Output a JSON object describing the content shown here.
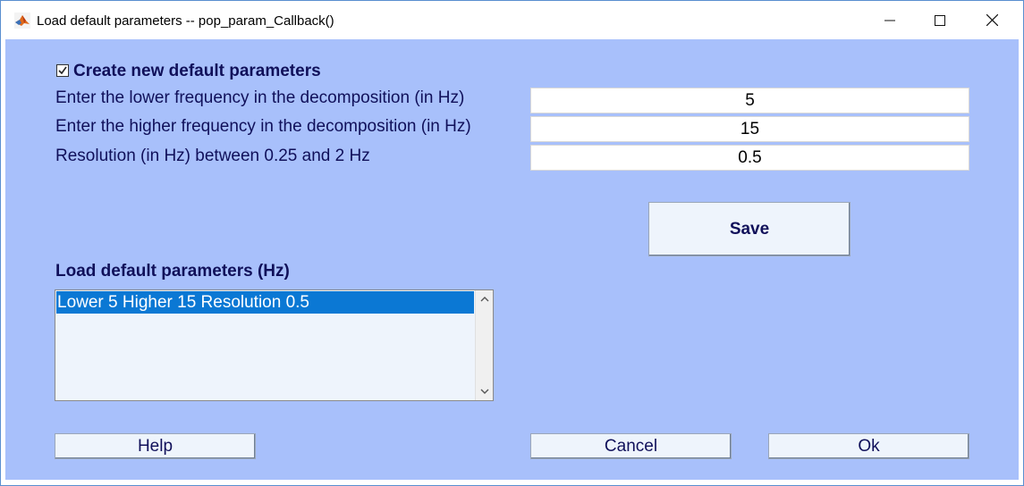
{
  "window": {
    "title": "Load default parameters -- pop_param_Callback()",
    "minimize_glyph": "—",
    "maximize_glyph": "☐",
    "close_glyph": "✕"
  },
  "form": {
    "checkbox_label": "Create new default parameters",
    "checkbox_checked": true,
    "lower_freq_label": "Enter the lower frequency in the decomposition (in Hz)",
    "lower_freq_value": "5",
    "higher_freq_label": "Enter the higher frequency in the decomposition (in Hz)",
    "higher_freq_value": "15",
    "resolution_label": "Resolution (in Hz) between 0.25 and 2 Hz",
    "resolution_value": "0.5",
    "save_label": "Save"
  },
  "defaults": {
    "heading": "Load default parameters (Hz)",
    "items": [
      "Lower 5  Higher 15  Resolution 0.5"
    ]
  },
  "buttons": {
    "help": "Help",
    "cancel": "Cancel",
    "ok": "Ok"
  },
  "colors": {
    "client_bg": "#a8c0fb",
    "selection": "#0b78d4",
    "label_text": "#10105a"
  }
}
